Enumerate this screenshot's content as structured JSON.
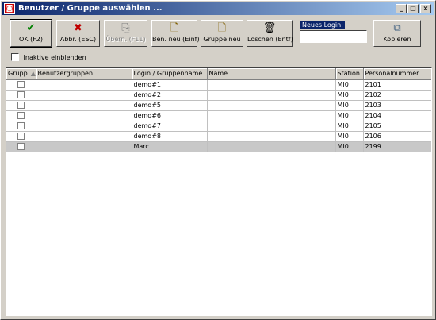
{
  "window": {
    "title": "Benutzer / Gruppe auswählen ...",
    "icon": "app-icon",
    "controls": {
      "minimize": "_",
      "maximize": "□",
      "close": "×"
    }
  },
  "toolbar": {
    "ok": {
      "label": "OK (F2)",
      "icon": "checkmark-icon",
      "color": "#008000"
    },
    "cancel": {
      "label": "Abbr. (ESC)",
      "icon": "cross-icon",
      "color": "#c00000"
    },
    "transfer": {
      "label": "Übern. (F11)",
      "icon": "transfer-icon",
      "disabled": true
    },
    "new_user": {
      "label": "Ben. neu (Einf)",
      "icon": "new-document-icon"
    },
    "new_group": {
      "label": "Gruppe neu",
      "icon": "new-document-icon"
    },
    "delete": {
      "label": "Löschen (Entf)",
      "icon": "trash-icon"
    },
    "copy": {
      "label": "Kopieren",
      "icon": "copy-users-icon"
    }
  },
  "new_login": {
    "label": "Neues Login:",
    "value": ""
  },
  "show_inactive": {
    "label": "Inaktive einblenden",
    "checked": false
  },
  "table": {
    "columns": [
      "Grupp",
      "Benutzergruppen",
      "Login / Gruppenname",
      "Name",
      "Station",
      "Personalnummer"
    ],
    "sort_indicator": "▲",
    "rows": [
      {
        "gruppe": false,
        "benutzergruppen": "",
        "login": "demo#1",
        "name": "",
        "station": "MI0",
        "personalnummer": "2101"
      },
      {
        "gruppe": false,
        "benutzergruppen": "",
        "login": "demo#2",
        "name": "",
        "station": "MI0",
        "personalnummer": "2102"
      },
      {
        "gruppe": false,
        "benutzergruppen": "",
        "login": "demo#5",
        "name": "",
        "station": "MI0",
        "personalnummer": "2103"
      },
      {
        "gruppe": false,
        "benutzergruppen": "",
        "login": "demo#6",
        "name": "",
        "station": "MI0",
        "personalnummer": "2104"
      },
      {
        "gruppe": false,
        "benutzergruppen": "",
        "login": "demo#7",
        "name": "",
        "station": "MI0",
        "personalnummer": "2105"
      },
      {
        "gruppe": false,
        "benutzergruppen": "",
        "login": "demo#8",
        "name": "",
        "station": "MI0",
        "personalnummer": "2106"
      },
      {
        "gruppe": false,
        "benutzergruppen": "",
        "login": "Marc",
        "name": "",
        "station": "MI0",
        "personalnummer": "2199",
        "selected": true
      }
    ]
  }
}
